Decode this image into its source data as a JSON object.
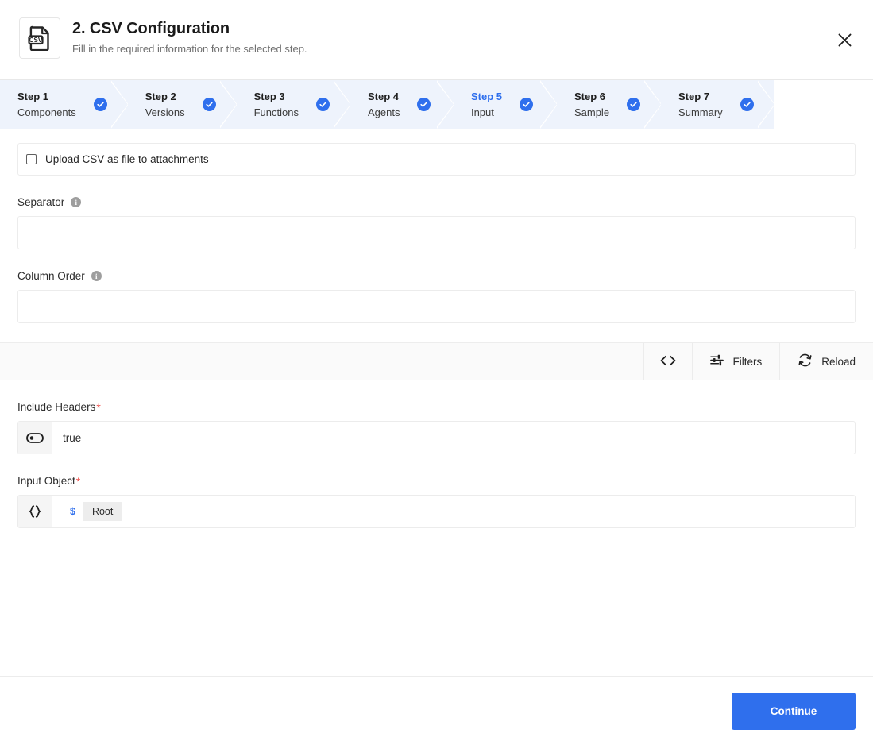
{
  "header": {
    "icon": "csv-file-icon",
    "title": "2. CSV Configuration",
    "subtitle": "Fill in the required information for the selected step.",
    "close_icon": "close-icon"
  },
  "stepper": {
    "steps": [
      {
        "num": "Step 1",
        "label": "Components",
        "state": "complete"
      },
      {
        "num": "Step 2",
        "label": "Versions",
        "state": "complete"
      },
      {
        "num": "Step 3",
        "label": "Functions",
        "state": "complete"
      },
      {
        "num": "Step 4",
        "label": "Agents",
        "state": "complete"
      },
      {
        "num": "Step 5",
        "label": "Input",
        "state": "active"
      },
      {
        "num": "Step 6",
        "label": "Sample",
        "state": "complete"
      },
      {
        "num": "Step 7",
        "label": "Summary",
        "state": "complete"
      }
    ]
  },
  "form": {
    "upload_checkbox": {
      "label": "Upload CSV as file to attachments",
      "checked": false
    },
    "separator": {
      "label": "Separator",
      "value": "",
      "info": "i"
    },
    "column_order": {
      "label": "Column Order",
      "value": "",
      "info": "i"
    },
    "include_headers": {
      "label": "Include Headers",
      "required": "*",
      "value": "true",
      "prefix_icon": "toggle-icon"
    },
    "input_object": {
      "label": "Input Object",
      "required": "*",
      "prefix_icon": "braces-icon",
      "chip_sigil": "$",
      "chip_name": "Root"
    }
  },
  "toolbar": {
    "code_icon": "code-brackets-icon",
    "filters_label": "Filters",
    "filters_icon": "sliders-icon",
    "reload_label": "Reload",
    "reload_icon": "refresh-icon"
  },
  "footer": {
    "continue_label": "Continue"
  },
  "colors": {
    "accent": "#2f6fed",
    "step_bg": "#eef3fc",
    "required": "#f0534f",
    "toolbar_bg": "#fafafa"
  }
}
